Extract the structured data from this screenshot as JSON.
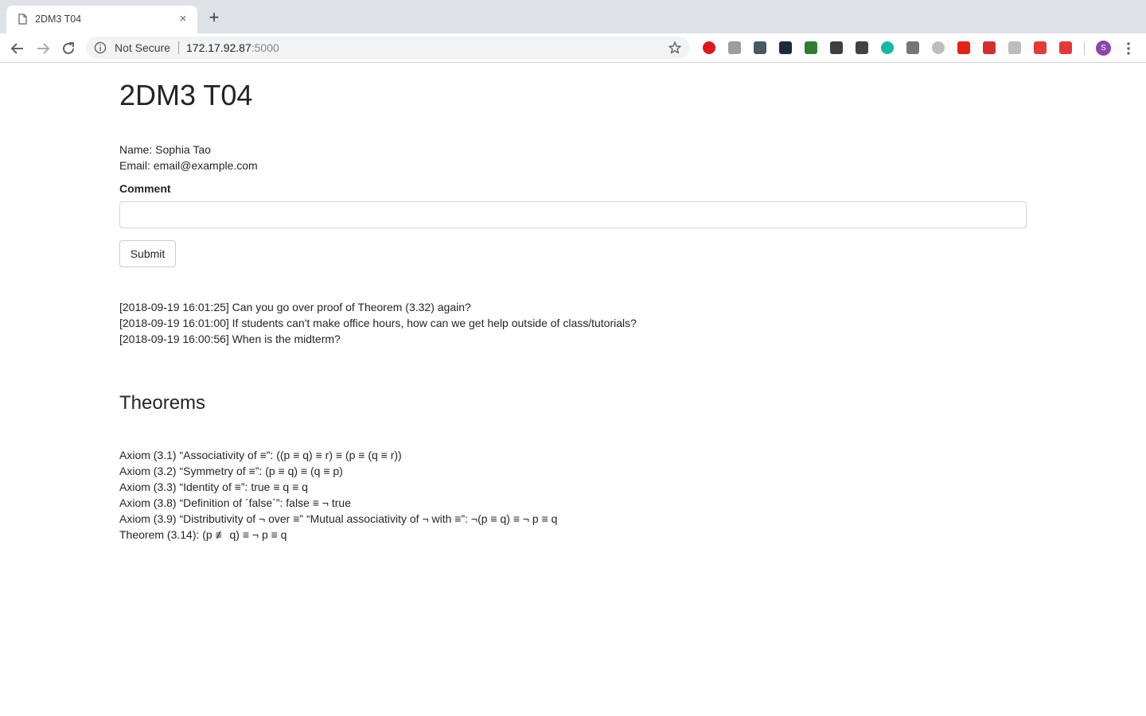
{
  "browser": {
    "tab": {
      "title": "2DM3 T04",
      "close": "×"
    },
    "newtab": "+",
    "omnibox": {
      "security_label": "Not Secure",
      "url_host": "172.17.92.87",
      "url_port": ":5000"
    },
    "profile_initial": "S",
    "extensions": [
      {
        "name": "opera-icon",
        "color": "#e0161e"
      },
      {
        "name": "ds-icon",
        "color": "#9e9e9e"
      },
      {
        "name": "eyedropper-icon",
        "color": "#455a64"
      },
      {
        "name": "code-icon",
        "color": "#1e2a3a"
      },
      {
        "name": "arc-icon",
        "color": "#2e7d32"
      },
      {
        "name": "radiation-icon",
        "color": "#3c4043"
      },
      {
        "name": "w-icon",
        "color": "#424242"
      },
      {
        "name": "m-icon",
        "color": "#17b8a6"
      },
      {
        "name": "camera-icon",
        "color": "#757575"
      },
      {
        "name": "fo-icon",
        "color": "#bdbdbd"
      },
      {
        "name": "youtube-icon",
        "color": "#e62117"
      },
      {
        "name": "cors-icon",
        "color": "#d32f2f"
      },
      {
        "name": "bulb-icon",
        "color": "#bdbdbd"
      },
      {
        "name": "dots-icon",
        "color": "#e53935"
      },
      {
        "name": "folder-icon",
        "color": "#e53935"
      }
    ]
  },
  "page": {
    "title": "2DM3 T04",
    "name_line": "Name: Sophia Tao",
    "email_line": "Email: email@example.com",
    "comment_label": "Comment",
    "comment_value": "",
    "submit_label": "Submit",
    "comments": [
      "[2018-09-19 16:01:25] Can you go over proof of Theorem (3.32) again?",
      "[2018-09-19 16:01:00] If students can't make office hours, how can we get help outside of class/tutorials?",
      "[2018-09-19 16:00:56] When is the midterm?"
    ],
    "theorems_title": "Theorems",
    "theorems": [
      "Axiom (3.1) “Associativity of ≡”: ((p ≡ q) ≡ r) ≡ (p ≡ (q ≡ r))",
      "Axiom (3.2) “Symmetry of ≡”: (p ≡ q) ≡ (q ≡ p)",
      "Axiom (3.3) “Identity of ≡”: true ≡ q ≡ q",
      "Axiom (3.8) “Definition of `false`”: false ≡ ¬ true",
      "Axiom (3.9) “Distributivity of ¬ over ≡” “Mutual associativity of ¬ with ≡”: ¬(p ≡ q) ≡ ¬ p ≡ q",
      "Theorem (3.14): (p ≢ q) ≡ ¬ p ≡ q"
    ]
  }
}
